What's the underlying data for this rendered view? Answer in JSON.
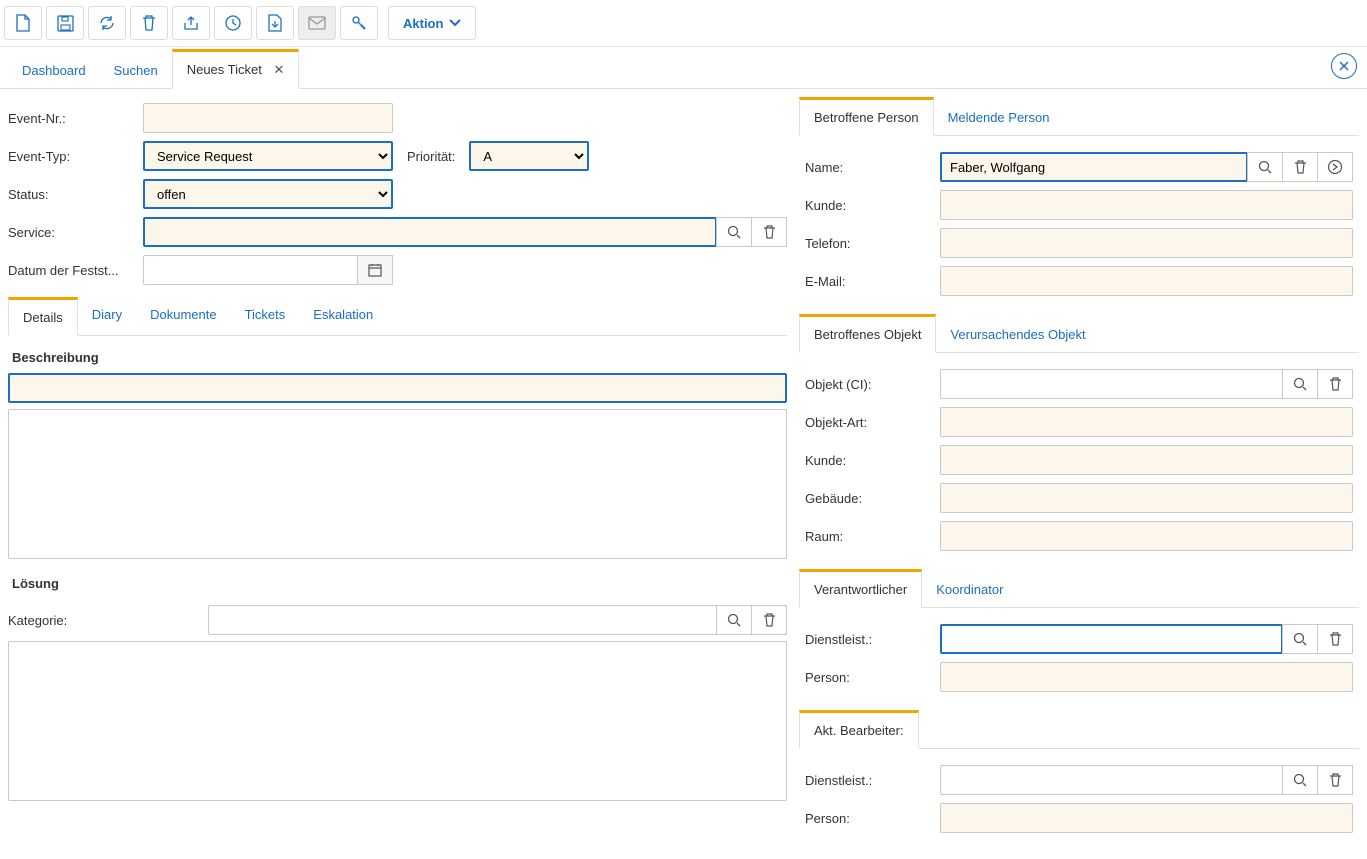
{
  "toolbar": {
    "aktion_label": "Aktion"
  },
  "maintabs": {
    "dashboard": "Dashboard",
    "suchen": "Suchen",
    "neues_ticket": "Neues Ticket"
  },
  "left_form": {
    "event_nr_label": "Event-Nr.:",
    "event_nr_value": "",
    "event_typ_label": "Event-Typ:",
    "event_typ_value": "Service Request",
    "prioritaet_label": "Priorität:",
    "prioritaet_value": "A",
    "status_label": "Status:",
    "status_value": "offen",
    "service_label": "Service:",
    "service_value": "",
    "datum_label": "Datum der Festst...",
    "datum_value": ""
  },
  "subtabs": {
    "details": "Details",
    "diary": "Diary",
    "dokumente": "Dokumente",
    "tickets": "Tickets",
    "eskalation": "Eskalation"
  },
  "details": {
    "beschreibung_label": "Beschreibung",
    "beschreibung_title_value": "",
    "beschreibung_body_value": "",
    "loesung_label": "Lösung",
    "kategorie_label": "Kategorie:",
    "kategorie_value": "",
    "loesung_body_value": ""
  },
  "panel_person": {
    "tab_betroffene": "Betroffene Person",
    "tab_meldende": "Meldende Person",
    "name_label": "Name:",
    "name_value": "Faber, Wolfgang",
    "kunde_label": "Kunde:",
    "kunde_value": "",
    "telefon_label": "Telefon:",
    "telefon_value": "",
    "email_label": "E-Mail:",
    "email_value": ""
  },
  "panel_objekt": {
    "tab_betroffenes": "Betroffenes Objekt",
    "tab_verursachend": "Verursachendes Objekt",
    "objekt_label": "Objekt (CI):",
    "objekt_value": "",
    "objektart_label": "Objekt-Art:",
    "objektart_value": "",
    "kunde_label": "Kunde:",
    "kunde_value": "",
    "gebaeude_label": "Gebäude:",
    "gebaeude_value": "",
    "raum_label": "Raum:",
    "raum_value": ""
  },
  "panel_verantw": {
    "tab_verantw": "Verantwortlicher",
    "tab_koord": "Koordinator",
    "dienstleist_label": "Dienstleist.:",
    "dienstleist_value": "",
    "person_label": "Person:",
    "person_value": ""
  },
  "panel_bearbeiter": {
    "tab": "Akt. Bearbeiter:",
    "dienstleist_label": "Dienstleist.:",
    "dienstleist_value": "",
    "person_label": "Person:",
    "person_value": ""
  }
}
